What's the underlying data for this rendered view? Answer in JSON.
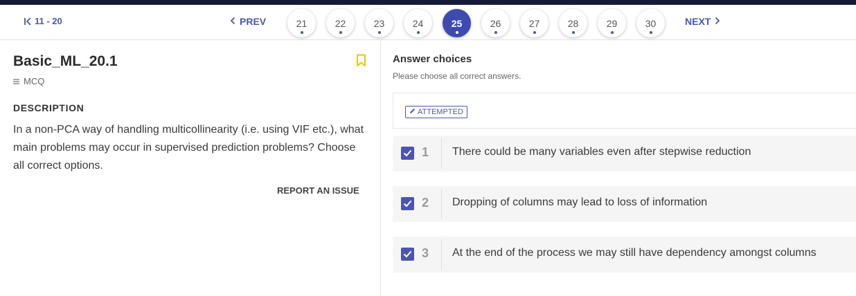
{
  "nav": {
    "range_label": "11 - 20",
    "prev_label": "PREV",
    "next_label": "NEXT",
    "pages": [
      "21",
      "22",
      "23",
      "24",
      "25",
      "26",
      "27",
      "28",
      "29",
      "30"
    ],
    "current_page": "25"
  },
  "question": {
    "title": "Basic_ML_20.1",
    "type": "MCQ",
    "description_heading": "DESCRIPTION",
    "description": "In a non-PCA way of handling multicollinearity (i.e. using VIF etc.), what main problems may occur in supervised prediction problems? Choose all correct options.",
    "report_label": "REPORT AN ISSUE",
    "bookmark_icon": "bookmark-icon"
  },
  "answers": {
    "heading": "Answer choices",
    "subheading": "Please choose all correct answers.",
    "status_badge": "ATTEMPTED",
    "choices": [
      {
        "number": "1",
        "text": "There could be many variables even after stepwise reduction",
        "checked": true
      },
      {
        "number": "2",
        "text": "Dropping of columns may lead to loss of information",
        "checked": true
      },
      {
        "number": "3",
        "text": "At the end of the process we may still have dependency amongst columns",
        "checked": true
      }
    ]
  },
  "colors": {
    "accent": "#3f4ab0",
    "top_strip": "#151a3b",
    "bookmark": "#f2c200"
  }
}
